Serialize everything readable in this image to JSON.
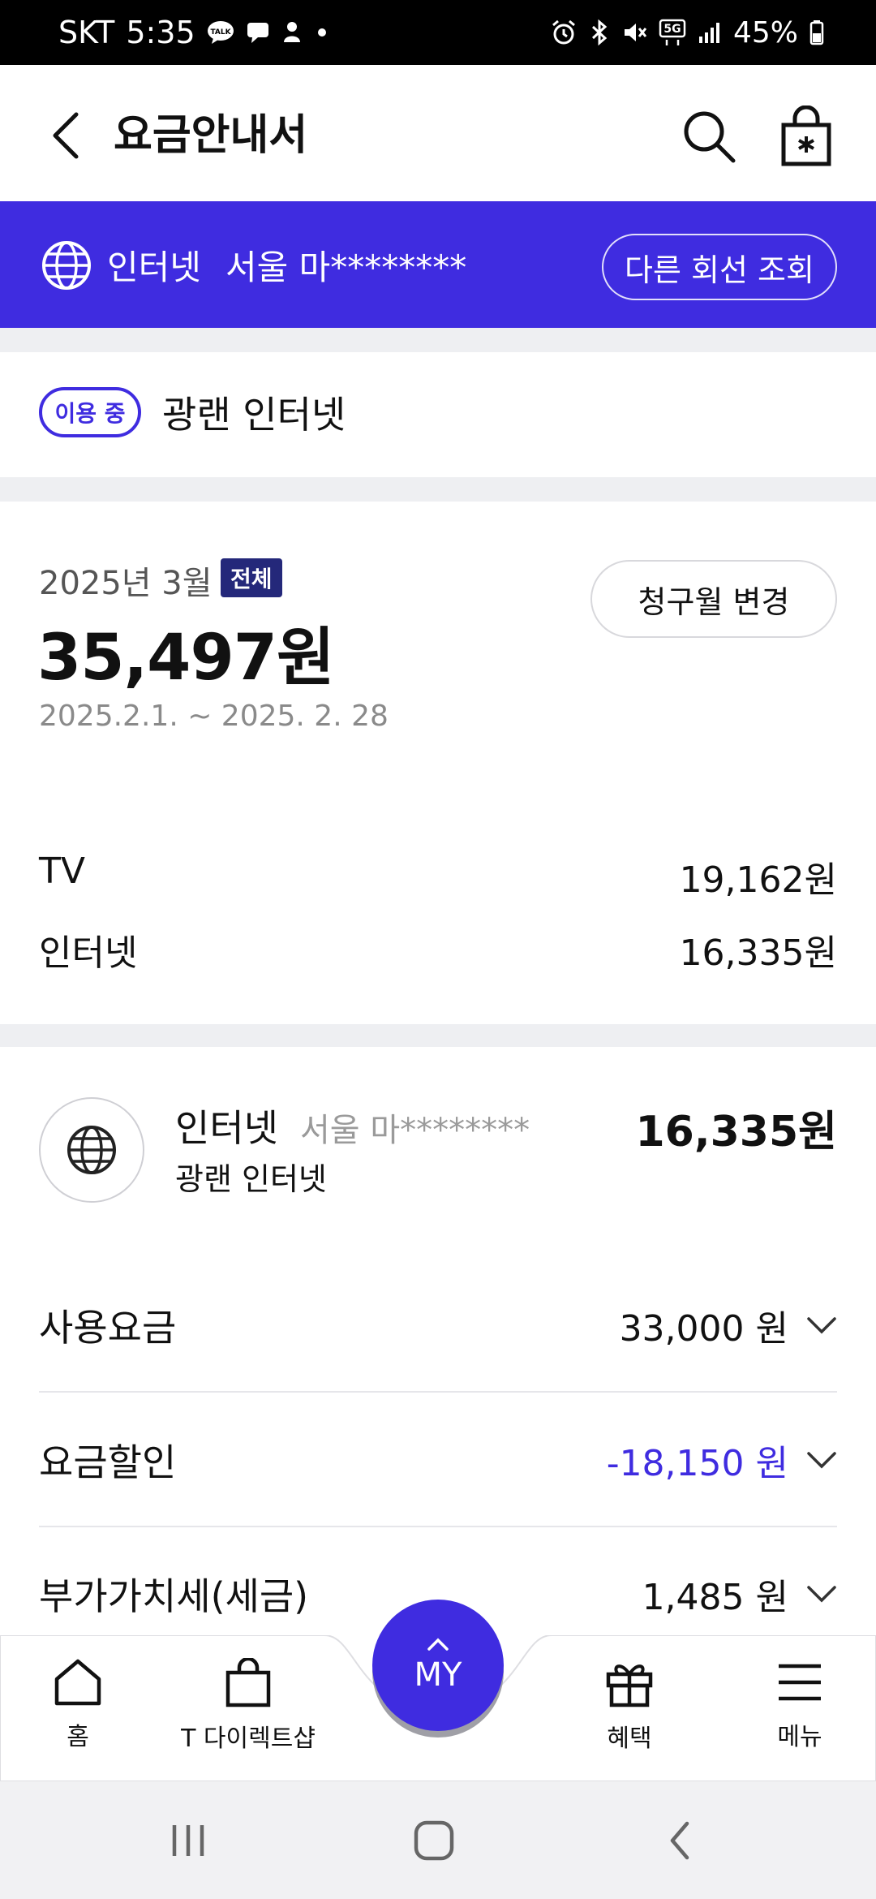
{
  "status_bar": {
    "carrier": "SKT",
    "time": "5:35",
    "battery": "45%",
    "left_icons": [
      "kakaotalk-icon",
      "chat-bubble-icon",
      "notification-icon",
      "dot-icon"
    ],
    "right_icons": [
      "alarm-icon",
      "bluetooth-icon",
      "mute-icon",
      "5g-icon",
      "signal-icon",
      "battery-icon"
    ],
    "network_badge": "5G"
  },
  "header": {
    "title": "요금안내서",
    "icons": [
      "back-icon",
      "search-icon",
      "shopping-bag-icon"
    ]
  },
  "line_banner": {
    "service": "인터넷",
    "line_id": "서울 마********",
    "other_line_button": "다른 회선 조회",
    "background": "#3f2ce0"
  },
  "plan": {
    "status": "이용 중",
    "name": "광랜 인터넷"
  },
  "bill": {
    "month": "2025년 3월",
    "scope_badge": "전체",
    "total": "35,497원",
    "period": "2025.2.1. ~ 2025. 2. 28",
    "change_month_button": "청구월 변경",
    "breakdown": [
      {
        "label": "TV",
        "amount": "19,162원"
      },
      {
        "label": "인터넷",
        "amount": "16,335원"
      }
    ]
  },
  "detail": {
    "service": "인터넷",
    "line_id": "서울 마********",
    "plan": "광랜 인터넷",
    "amount": "16,335원",
    "rows": [
      {
        "label": "사용요금",
        "value": "33,000 원",
        "type": "normal"
      },
      {
        "label": "요금할인",
        "value": "-18,150 원",
        "type": "discount"
      },
      {
        "label": "부가가치세(세금)",
        "value": "1,485 원",
        "type": "normal"
      }
    ]
  },
  "bottom_nav": {
    "items": [
      {
        "label": "홈",
        "icon": "home-icon"
      },
      {
        "label": "T 다이렉트샵",
        "icon": "shopping-bag-icon"
      },
      {
        "label": "혜택",
        "icon": "gift-icon"
      },
      {
        "label": "메뉴",
        "icon": "hamburger-menu-icon"
      }
    ],
    "center_button": "MY"
  },
  "system_nav": [
    "recent-apps-icon",
    "home-button-icon",
    "back-icon"
  ],
  "colors": {
    "accent": "#3f2ce0",
    "badge_dark": "#24287a",
    "muted_text": "#8a8a8a",
    "divider": "#eeeff2"
  }
}
